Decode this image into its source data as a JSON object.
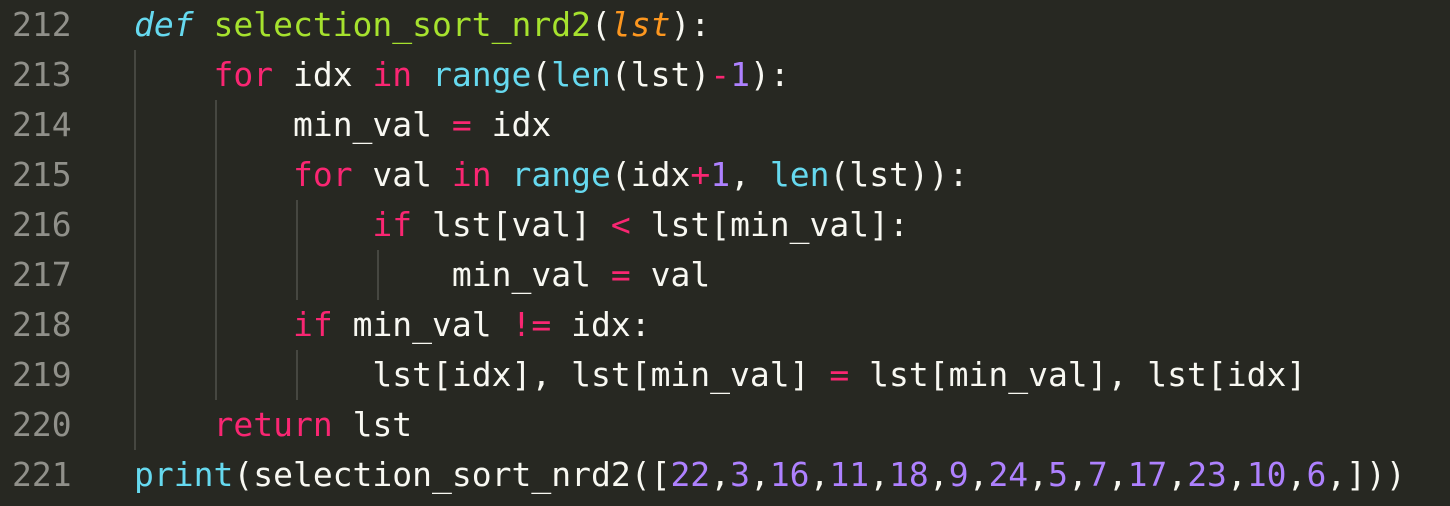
{
  "editor": {
    "background": "#272822",
    "gutter_color": "#90908a",
    "line_numbers": [
      "212",
      "213",
      "214",
      "215",
      "216",
      "217",
      "218",
      "219",
      "220",
      "221"
    ],
    "lines": [
      {
        "indent": "",
        "tokens": [
          {
            "t": "def",
            "c": "def"
          },
          {
            "t": " ",
            "c": "plain"
          },
          {
            "t": "selection_sort_nrd2",
            "c": "fn"
          },
          {
            "t": "(",
            "c": "plain"
          },
          {
            "t": "lst",
            "c": "param"
          },
          {
            "t": "):",
            "c": "plain"
          }
        ]
      },
      {
        "indent": "    ",
        "tokens": [
          {
            "t": "for",
            "c": "kw"
          },
          {
            "t": " idx ",
            "c": "plain"
          },
          {
            "t": "in",
            "c": "kw"
          },
          {
            "t": " ",
            "c": "plain"
          },
          {
            "t": "range",
            "c": "builtin"
          },
          {
            "t": "(",
            "c": "plain"
          },
          {
            "t": "len",
            "c": "builtin"
          },
          {
            "t": "(lst)",
            "c": "plain"
          },
          {
            "t": "-",
            "c": "op"
          },
          {
            "t": "1",
            "c": "num"
          },
          {
            "t": "):",
            "c": "plain"
          }
        ]
      },
      {
        "indent": "        ",
        "tokens": [
          {
            "t": "min_val ",
            "c": "plain"
          },
          {
            "t": "=",
            "c": "op"
          },
          {
            "t": " idx",
            "c": "plain"
          }
        ]
      },
      {
        "indent": "        ",
        "tokens": [
          {
            "t": "for",
            "c": "kw"
          },
          {
            "t": " val ",
            "c": "plain"
          },
          {
            "t": "in",
            "c": "kw"
          },
          {
            "t": " ",
            "c": "plain"
          },
          {
            "t": "range",
            "c": "builtin"
          },
          {
            "t": "(idx",
            "c": "plain"
          },
          {
            "t": "+",
            "c": "op"
          },
          {
            "t": "1",
            "c": "num"
          },
          {
            "t": ", ",
            "c": "plain"
          },
          {
            "t": "len",
            "c": "builtin"
          },
          {
            "t": "(lst)):",
            "c": "plain"
          }
        ]
      },
      {
        "indent": "            ",
        "tokens": [
          {
            "t": "if",
            "c": "kw"
          },
          {
            "t": " lst[val] ",
            "c": "plain"
          },
          {
            "t": "<",
            "c": "op"
          },
          {
            "t": " lst[min_val]:",
            "c": "plain"
          }
        ]
      },
      {
        "indent": "                ",
        "tokens": [
          {
            "t": "min_val ",
            "c": "plain"
          },
          {
            "t": "=",
            "c": "op"
          },
          {
            "t": " val",
            "c": "plain"
          }
        ]
      },
      {
        "indent": "        ",
        "tokens": [
          {
            "t": "if",
            "c": "kw"
          },
          {
            "t": " min_val ",
            "c": "plain"
          },
          {
            "t": "!=",
            "c": "op"
          },
          {
            "t": " idx:",
            "c": "plain"
          }
        ]
      },
      {
        "indent": "            ",
        "tokens": [
          {
            "t": "lst[idx], lst[min_val] ",
            "c": "plain"
          },
          {
            "t": "=",
            "c": "op"
          },
          {
            "t": " lst[min_val], lst[idx]",
            "c": "plain"
          }
        ]
      },
      {
        "indent": "    ",
        "tokens": [
          {
            "t": "return",
            "c": "kw"
          },
          {
            "t": " lst",
            "c": "plain"
          }
        ]
      },
      {
        "indent": "",
        "tokens": [
          {
            "t": "print",
            "c": "builtin"
          },
          {
            "t": "(selection_sort_nrd2([",
            "c": "plain"
          },
          {
            "t": "22",
            "c": "num"
          },
          {
            "t": ",",
            "c": "plain"
          },
          {
            "t": "3",
            "c": "num"
          },
          {
            "t": ",",
            "c": "plain"
          },
          {
            "t": "16",
            "c": "num"
          },
          {
            "t": ",",
            "c": "plain"
          },
          {
            "t": "11",
            "c": "num"
          },
          {
            "t": ",",
            "c": "plain"
          },
          {
            "t": "18",
            "c": "num"
          },
          {
            "t": ",",
            "c": "plain"
          },
          {
            "t": "9",
            "c": "num"
          },
          {
            "t": ",",
            "c": "plain"
          },
          {
            "t": "24",
            "c": "num"
          },
          {
            "t": ",",
            "c": "plain"
          },
          {
            "t": "5",
            "c": "num"
          },
          {
            "t": ",",
            "c": "plain"
          },
          {
            "t": "7",
            "c": "num"
          },
          {
            "t": ",",
            "c": "plain"
          },
          {
            "t": "17",
            "c": "num"
          },
          {
            "t": ",",
            "c": "plain"
          },
          {
            "t": "23",
            "c": "num"
          },
          {
            "t": ",",
            "c": "plain"
          },
          {
            "t": "10",
            "c": "num"
          },
          {
            "t": ",",
            "c": "plain"
          },
          {
            "t": "6",
            "c": "num"
          },
          {
            "t": ",]))",
            "c": "plain"
          }
        ]
      }
    ]
  }
}
